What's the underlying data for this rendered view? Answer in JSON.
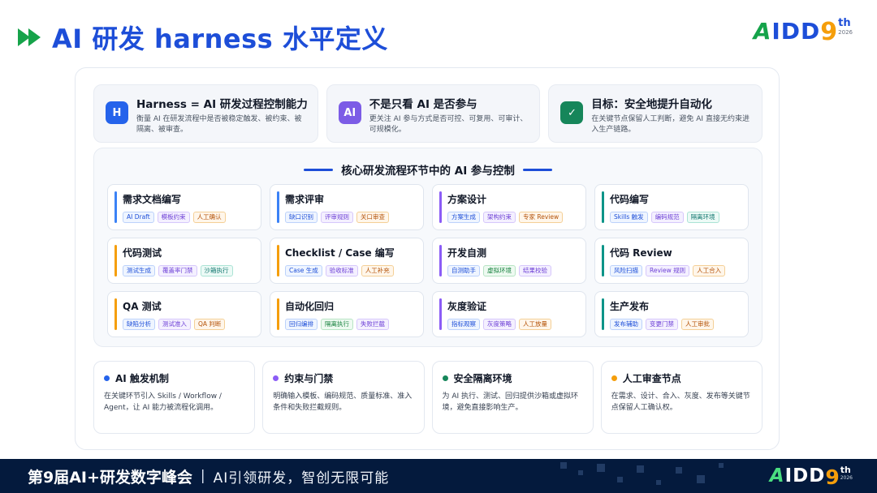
{
  "header": {
    "title": "AI 研发 harness 水平定义",
    "logo": {
      "brand_a": "A",
      "brand_rest": "IDD",
      "edition_num": "9",
      "edition_suffix": "th",
      "year": "2026"
    }
  },
  "top_cards": [
    {
      "badge": "H",
      "color": "#2563eb",
      "title": "Harness = AI 研发过程控制能力",
      "desc": "衡量 AI 在研发流程中是否被稳定触发、被约束、被隔离、被审查。"
    },
    {
      "badge": "AI",
      "color": "#7c5ce6",
      "title": "不是只看 AI 是否参与",
      "desc": "更关注 AI 参与方式是否可控、可复用、可审计、可规模化。"
    },
    {
      "badge": "✓",
      "color": "#16865a",
      "title": "目标：安全地提升自动化",
      "desc": "在关键节点保留人工判断，避免 AI 直接无约束进入生产链路。"
    }
  ],
  "core": {
    "title": "核心研发流程环节中的 AI 参与控制",
    "stages": [
      {
        "title": "需求文档编写",
        "bar": "#3b82f6",
        "chips": [
          {
            "label": "AI Draft",
            "tone": "blue"
          },
          {
            "label": "模板约束",
            "tone": "purple"
          },
          {
            "label": "人工确认",
            "tone": "orange"
          }
        ]
      },
      {
        "title": "需求评审",
        "bar": "#3b82f6",
        "chips": [
          {
            "label": "缺口识别",
            "tone": "blue"
          },
          {
            "label": "评审规则",
            "tone": "purple"
          },
          {
            "label": "关口审查",
            "tone": "orange"
          }
        ]
      },
      {
        "title": "方案设计",
        "bar": "#8b5cf6",
        "chips": [
          {
            "label": "方案生成",
            "tone": "blue"
          },
          {
            "label": "架构约束",
            "tone": "purple"
          },
          {
            "label": "专家 Review",
            "tone": "orange"
          }
        ]
      },
      {
        "title": "代码编写",
        "bar": "#0d9488",
        "chips": [
          {
            "label": "Skills 触发",
            "tone": "blue"
          },
          {
            "label": "编码规范",
            "tone": "purple"
          },
          {
            "label": "隔离环境",
            "tone": "teal"
          }
        ]
      },
      {
        "title": "代码测试",
        "bar": "#f59e0b",
        "chips": [
          {
            "label": "测试生成",
            "tone": "blue"
          },
          {
            "label": "覆盖率门禁",
            "tone": "purple"
          },
          {
            "label": "沙箱执行",
            "tone": "teal"
          }
        ]
      },
      {
        "title": "Checklist / Case 编写",
        "bar": "#f59e0b",
        "chips": [
          {
            "label": "Case 生成",
            "tone": "blue"
          },
          {
            "label": "验收标准",
            "tone": "purple"
          },
          {
            "label": "人工补充",
            "tone": "orange"
          }
        ]
      },
      {
        "title": "开发自测",
        "bar": "#8b5cf6",
        "chips": [
          {
            "label": "自测助手",
            "tone": "blue"
          },
          {
            "label": "虚拟环境",
            "tone": "green"
          },
          {
            "label": "结果校验",
            "tone": "purple"
          }
        ]
      },
      {
        "title": "代码 Review",
        "bar": "#0d9488",
        "chips": [
          {
            "label": "风险扫描",
            "tone": "blue"
          },
          {
            "label": "Review 规则",
            "tone": "purple"
          },
          {
            "label": "人工合入",
            "tone": "orange"
          }
        ]
      },
      {
        "title": "QA 测试",
        "bar": "#f59e0b",
        "chips": [
          {
            "label": "缺陷分析",
            "tone": "blue"
          },
          {
            "label": "测试准入",
            "tone": "purple"
          },
          {
            "label": "QA 判断",
            "tone": "orange"
          }
        ]
      },
      {
        "title": "自动化回归",
        "bar": "#f59e0b",
        "chips": [
          {
            "label": "回归编排",
            "tone": "blue"
          },
          {
            "label": "隔离执行",
            "tone": "green"
          },
          {
            "label": "失败拦截",
            "tone": "purple"
          }
        ]
      },
      {
        "title": "灰度验证",
        "bar": "#8b5cf6",
        "chips": [
          {
            "label": "指标观察",
            "tone": "blue"
          },
          {
            "label": "灰度策略",
            "tone": "purple"
          },
          {
            "label": "人工放量",
            "tone": "orange"
          }
        ]
      },
      {
        "title": "生产发布",
        "bar": "#0d9488",
        "chips": [
          {
            "label": "发布辅助",
            "tone": "blue"
          },
          {
            "label": "变更门禁",
            "tone": "purple"
          },
          {
            "label": "人工审批",
            "tone": "orange"
          }
        ]
      }
    ]
  },
  "bottom_cards": [
    {
      "dot": "#2563eb",
      "title": "AI 触发机制",
      "desc": "在关键环节引入 Skills / Workflow / Agent，让 AI 能力被流程化调用。"
    },
    {
      "dot": "#8b5cf6",
      "title": "约束与门禁",
      "desc": "明确输入模板、编码规范、质量标准、准入条件和失败拦截规则。"
    },
    {
      "dot": "#16865a",
      "title": "安全隔离环境",
      "desc": "为 AI 执行、测试、回归提供沙箱或虚拟环境，避免直接影响生产。"
    },
    {
      "dot": "#f59e0b",
      "title": "人工审查节点",
      "desc": "在需求、设计、合入、灰度、发布等关键节点保留人工确认权。"
    }
  ],
  "footer": {
    "event": "第9届AI+研发数字峰会",
    "separator": "|",
    "slogan": "AI引领研发，智创无限可能"
  }
}
